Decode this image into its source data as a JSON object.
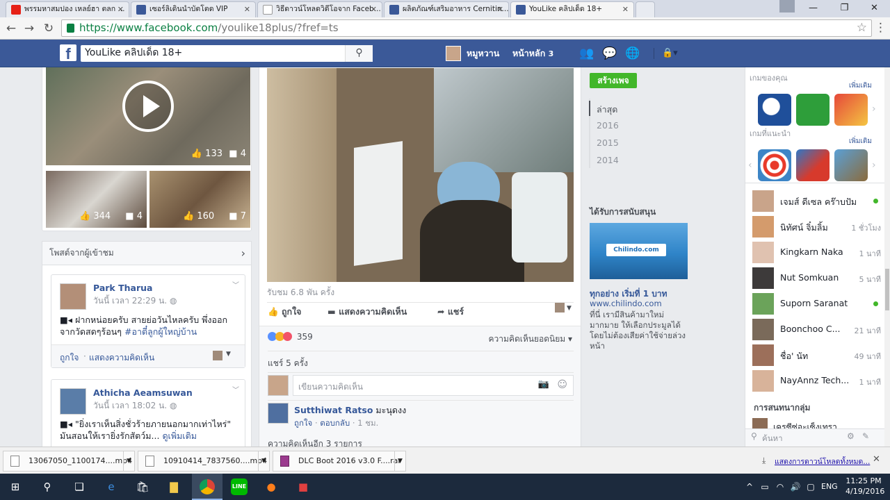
{
  "browser": {
    "tabs": [
      {
        "title": "พรรมหาสมปอง เหลย์ฮา ตลก ..."
      },
      {
        "title": "เซอร์ลิเดินนำบัตโตด VIP"
      },
      {
        "title": "วิธีดาวน์โหลดวิดีโอจาก Faceb..."
      },
      {
        "title": "ผลิตภัณฑ์เสริมอาหาร Cernitin..."
      },
      {
        "title": "YouLike คลิปเด็ด 18+"
      }
    ],
    "url_main": "https://www.facebook.com",
    "url_rest": "/youlike18plus/?fref=ts"
  },
  "fb": {
    "logo": "f",
    "search_value": "YouLike คลิปเด็ด 18+",
    "user_name": "หมูหวาน",
    "home_label": "หน้าหลัก",
    "home_count": "3"
  },
  "left": {
    "video_main": {
      "likes": "133",
      "comments": "4"
    },
    "video_small": [
      {
        "likes": "344",
        "comments": "4"
      },
      {
        "likes": "160",
        "comments": "7"
      }
    ],
    "visitor_posts_title": "โพสต์จากผู้เข้าชม",
    "posts": [
      {
        "name": "Park Tharua",
        "time": "วันนี้ เวลา 22:29 น.",
        "text": "■◂ ฝากหน่อยครับ สายย่อวันไหลครับ พึ่งออกจากวัดสดๆร้อนๆ",
        "tag": "#อาตี๋ลูกผู้ใหญ่บ้าน",
        "like": "ถูกใจ",
        "comment": "แสดงความคิดเห็น"
      },
      {
        "name": "Athicha Aeamsuwan",
        "time": "วันนี้ เวลา 18:02 น.",
        "text": "■◂ \"ยิ่งเราเห็นสิ่งชั่วร้ายภายนอกมากเท่าไหร่\" มันสอนให้เรายิ่งรักสัตว์ม...",
        "more": "ดูเพิ่มเติม"
      }
    ]
  },
  "center": {
    "views": "รับชม 6.8 พัน ครั้ง",
    "like": "ถูกใจ",
    "comment": "แสดงความคิดเห็น",
    "share": "แชร์",
    "reactions": "359",
    "sort": "ความคิดเห็นยอดนิยม",
    "shares": "แชร์ 5 ครั้ง",
    "comment_placeholder": "เขียนความคิดเห็น",
    "first_comment": {
      "name": "Sutthiwat Ratso",
      "text": "มะนุดงง",
      "like": "ถูกใจ",
      "reply": "ตอบกลับ",
      "time": "1 ชม."
    },
    "more_comments": "ความคิดเห็นอีก 3 รายการ"
  },
  "rightcol": {
    "create_page": "สร้างเพจ",
    "years": [
      "ล่าสุด",
      "2016",
      "2015",
      "2014"
    ],
    "sponsored": "ได้รับการสนับสนุน",
    "ad_title": "ทุกอย่าง เริ่มที่ 1 บาท",
    "ad_url": "www.chilindo.com",
    "ad_text": "ที่นี่ เรามีสินค้ามาใหม่มากมาย ให้เลือกประมูลได้ โดยไม่ต้องเสียค่าใช้จ่ายล่วงหน้า",
    "ad_brand": "Chilindo.com"
  },
  "sidebar": {
    "your_games": "เกมของคุณ",
    "more1": "เพิ่มเติม",
    "suggested_games": "เกมที่แนะนำ",
    "more2": "เพิ่มเติม",
    "contacts": [
      {
        "name": "เจมส์ ดีเซล คร๊าบปัม",
        "status": "online"
      },
      {
        "name": "นิทัศน์ จิ๋มลิ้ม",
        "status": "1 ชั่วโมง"
      },
      {
        "name": "Kingkarn Naka",
        "status": "1 นาที"
      },
      {
        "name": "Nut Somkuan",
        "status": "5 นาที"
      },
      {
        "name": "Suporn Saranat",
        "status": "online"
      },
      {
        "name": "Boonchoo C...",
        "status": "21 นาที"
      },
      {
        "name": "ชื่อ' นัท",
        "status": "49 นาที"
      },
      {
        "name": "NayAnnz Tech...",
        "status": "1 นาที"
      }
    ],
    "group_convos": "การสนทนากลุ่ม",
    "group_item": "เครซีซ่อะเซ็งเทรา",
    "search_placeholder": "ค้นหา"
  },
  "downloads": {
    "items": [
      "13067050_1100174....mp4",
      "10910414_7837560....mp4",
      "DLC Boot 2016 v3.0 F....rar"
    ],
    "show_all": "แสดงการดาวน์โหลดทั้งหมด..."
  },
  "taskbar": {
    "lang": "ENG",
    "time": "11:25 PM",
    "date": "4/19/2016"
  },
  "colors": {
    "fb_blue": "#3b5998",
    "link": "#365899",
    "green": "#42b72a"
  }
}
